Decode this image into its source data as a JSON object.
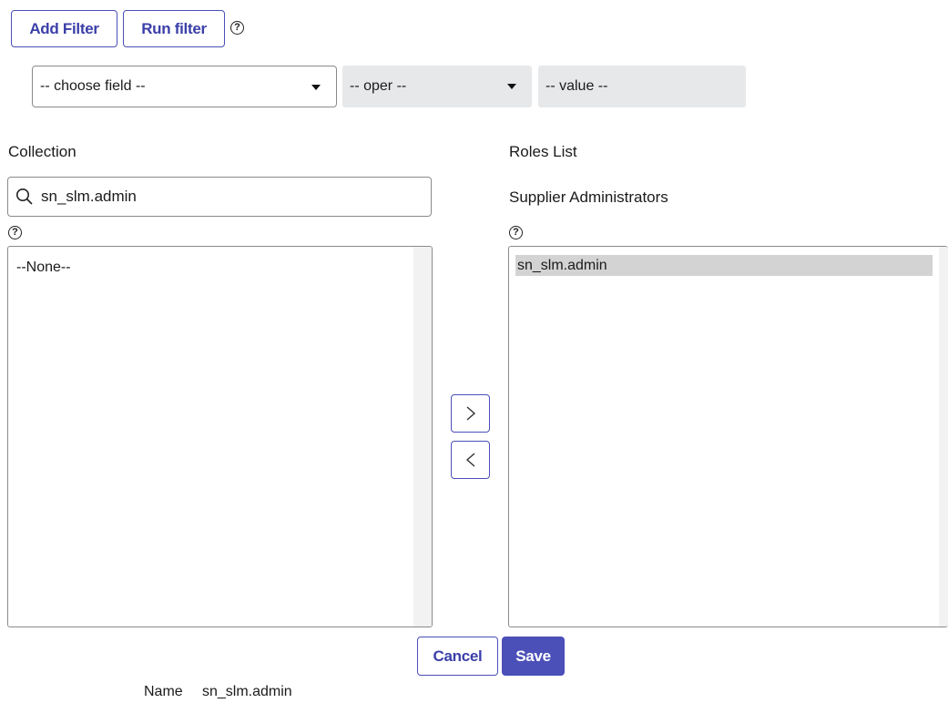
{
  "toolbar": {
    "add_filter_label": "Add Filter",
    "run_filter_label": "Run filter"
  },
  "filter": {
    "field_placeholder": "-- choose field --",
    "oper_placeholder": "-- oper --",
    "value_placeholder": "-- value --"
  },
  "collection": {
    "heading": "Collection",
    "search_value": "sn_slm.admin",
    "items": [
      "--None--"
    ]
  },
  "roles": {
    "heading": "Roles List",
    "subheading": "Supplier Administrators",
    "items": [
      "sn_slm.admin"
    ]
  },
  "actions": {
    "cancel_label": "Cancel",
    "save_label": "Save"
  },
  "footer": {
    "name_label": "Name",
    "name_value": "sn_slm.admin"
  },
  "colors": {
    "accent": "#4b4fb8",
    "selected_row": "#d3d3d3",
    "grey_field": "#e6e8ea"
  },
  "icons": {
    "help": "question-circle-icon",
    "search": "magnifier-icon",
    "add": "chevron-right-icon",
    "remove": "chevron-left-icon",
    "dropdown": "triangle-down-icon"
  }
}
